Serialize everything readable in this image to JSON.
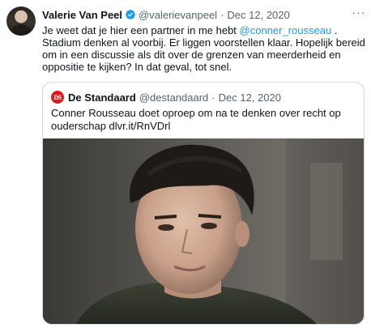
{
  "tweet": {
    "display_name": "Valerie Van Peel",
    "handle": "@valerievanpeel",
    "separator": "·",
    "date": "Dec 12, 2020",
    "more_label": "···",
    "text_part1": "Je weet dat je hier een partner in me hebt ",
    "mention": "@conner_rousseau",
    "text_part2": " . Stadium denken al voorbij. Er liggen voorstellen klaar. Hopelijk bereid om in een discussie als dit over de grenzen van meerderheid en oppositie te kijken? In dat geval, tot snel.",
    "icons": {
      "avatar": "avatar-photo",
      "verified": "verified-badge-icon",
      "more": "more-options-icon"
    },
    "colors": {
      "link": "#1d9bf0",
      "verified": "#1d9bf0",
      "muted": "#536471"
    }
  },
  "quote": {
    "logo_text": "DS",
    "display_name": "De Standaard",
    "handle": "@destandaard",
    "separator": "·",
    "date": "Dec 12, 2020",
    "text": "Conner Rousseau doet oproep om na te denken over recht op ouderschap dlvr.it/RnVDrl",
    "colors": {
      "logo": "#d81c24"
    }
  }
}
